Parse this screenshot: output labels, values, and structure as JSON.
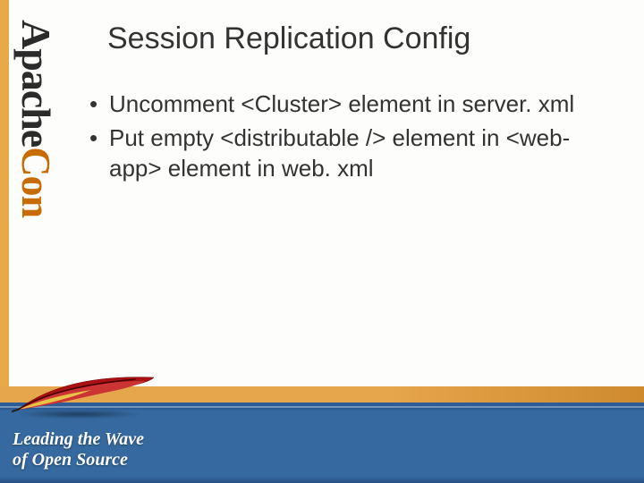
{
  "logo": {
    "apache": "Apache",
    "con": "Con"
  },
  "title": "Session Replication Config",
  "bullets": [
    "Uncomment <Cluster> element in server. xml",
    "Put empty <distributable /> element in <web-app> element in web. xml"
  ],
  "footer": {
    "tagline_line1": "Leading the Wave",
    "tagline_line2": "of Open Source"
  },
  "icons": {
    "feather": "feather-icon"
  }
}
